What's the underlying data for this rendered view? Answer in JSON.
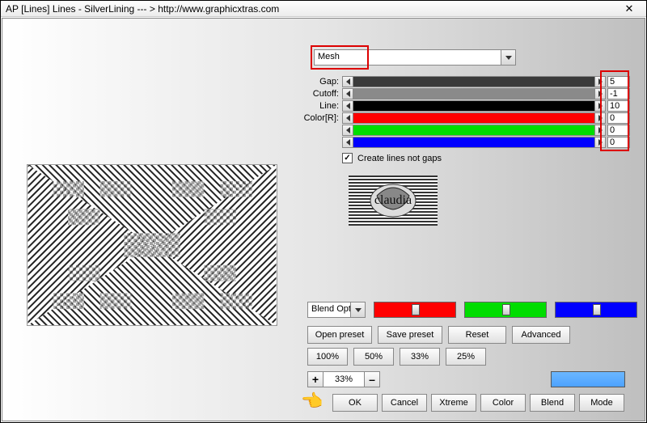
{
  "window": {
    "title": "AP [Lines]  Lines - SilverLining    --- >  http://www.graphicxtras.com"
  },
  "dropdown": {
    "mesh": "Mesh"
  },
  "sliders": {
    "rows": [
      {
        "label": "Gap:",
        "value": "5",
        "fill": "#3a3a3a",
        "pct": 100
      },
      {
        "label": "Cutoff:",
        "value": "-1",
        "fill": "#8a8a8a",
        "pct": 100
      },
      {
        "label": "Line:",
        "value": "10",
        "fill": "#000000",
        "pct": 100
      },
      {
        "label": "Color[R]:",
        "value": "0",
        "fill": "#ff0000",
        "pct": 100
      },
      {
        "label": "",
        "value": "0",
        "fill": "#00dd00",
        "pct": 100
      },
      {
        "label": "",
        "value": "0",
        "fill": "#0000ff",
        "pct": 100
      }
    ]
  },
  "checkbox": {
    "label": "Create lines not gaps",
    "checked": true
  },
  "logo_text": "claudia",
  "blend": {
    "combo": "Blend Option",
    "colors": [
      "#ff0000",
      "#00dd00",
      "#0000ff"
    ]
  },
  "buttons": {
    "row1": [
      "Open preset",
      "Save preset",
      "Reset",
      "Advanced"
    ],
    "row2": [
      "100%",
      "50%",
      "33%",
      "25%"
    ],
    "row3": [
      "OK",
      "Cancel",
      "Xtreme",
      "Color",
      "Blend",
      "Mode"
    ]
  },
  "zoom": {
    "plus": "+",
    "minus": "–",
    "value": "33%"
  },
  "swatch_color": "#5aaeff"
}
